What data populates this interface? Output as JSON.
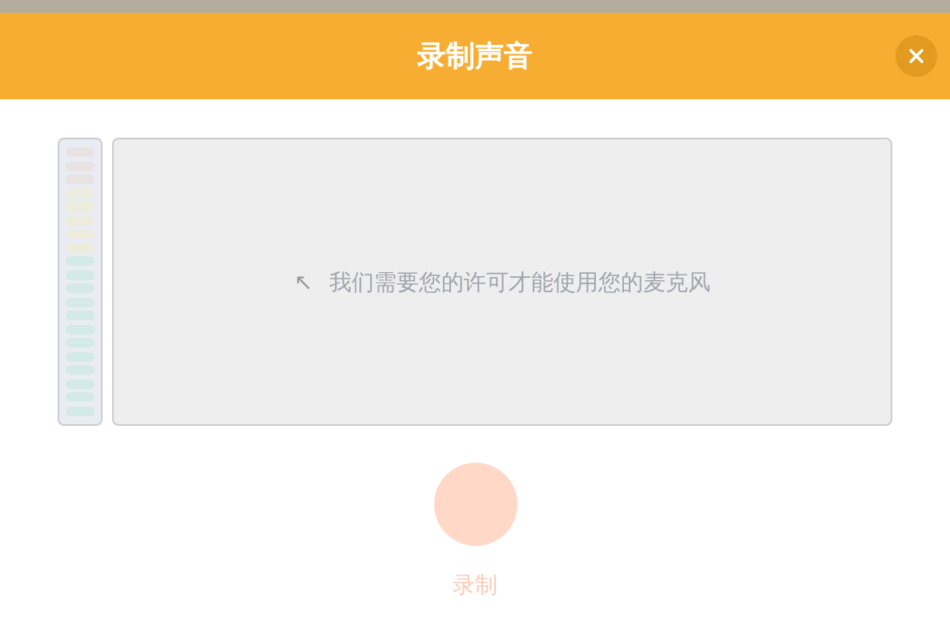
{
  "dialog": {
    "title": "录制声音"
  },
  "meter": {
    "level": 0
  },
  "prompt": {
    "arrow": "↖",
    "text": "我们需要您的许可才能使用您的麦克风"
  },
  "record_button": {
    "label": "录制",
    "disabled": true
  }
}
